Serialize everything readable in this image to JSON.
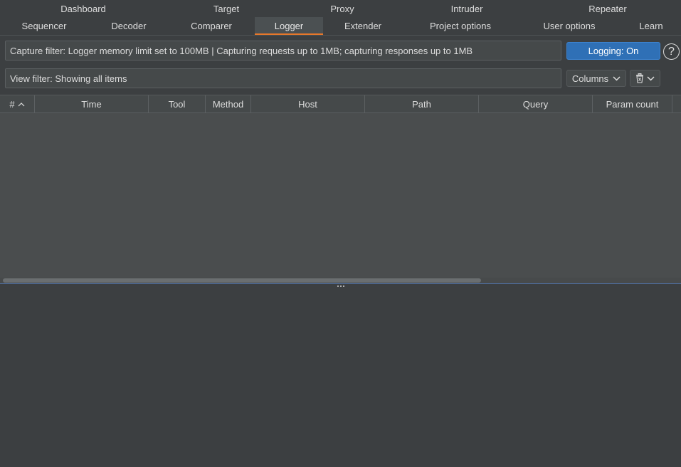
{
  "tabs": {
    "row1": [
      "Dashboard",
      "Target",
      "Proxy",
      "Intruder",
      "Repeater"
    ],
    "row2": [
      "Sequencer",
      "Decoder",
      "Comparer",
      "Logger",
      "Extender",
      "Project options",
      "User options",
      "Learn"
    ],
    "active": "Logger"
  },
  "filters": {
    "capture": "Capture filter: Logger memory limit set to 100MB | Capturing requests up to 1MB;  capturing responses up to 1MB",
    "view": "View filter: Showing all items"
  },
  "controls": {
    "logging_label": "Logging: On",
    "help_label": "?",
    "columns_label": "Columns"
  },
  "table": {
    "columns": [
      "#",
      "Time",
      "Tool",
      "Method",
      "Host",
      "Path",
      "Query",
      "Param count"
    ],
    "sort_column": "#",
    "sort_direction": "ascending",
    "rows": []
  },
  "colors": {
    "background": "#3c3f41",
    "active_tab_underline": "#e8782a",
    "logging_button": "#2f70b6"
  }
}
